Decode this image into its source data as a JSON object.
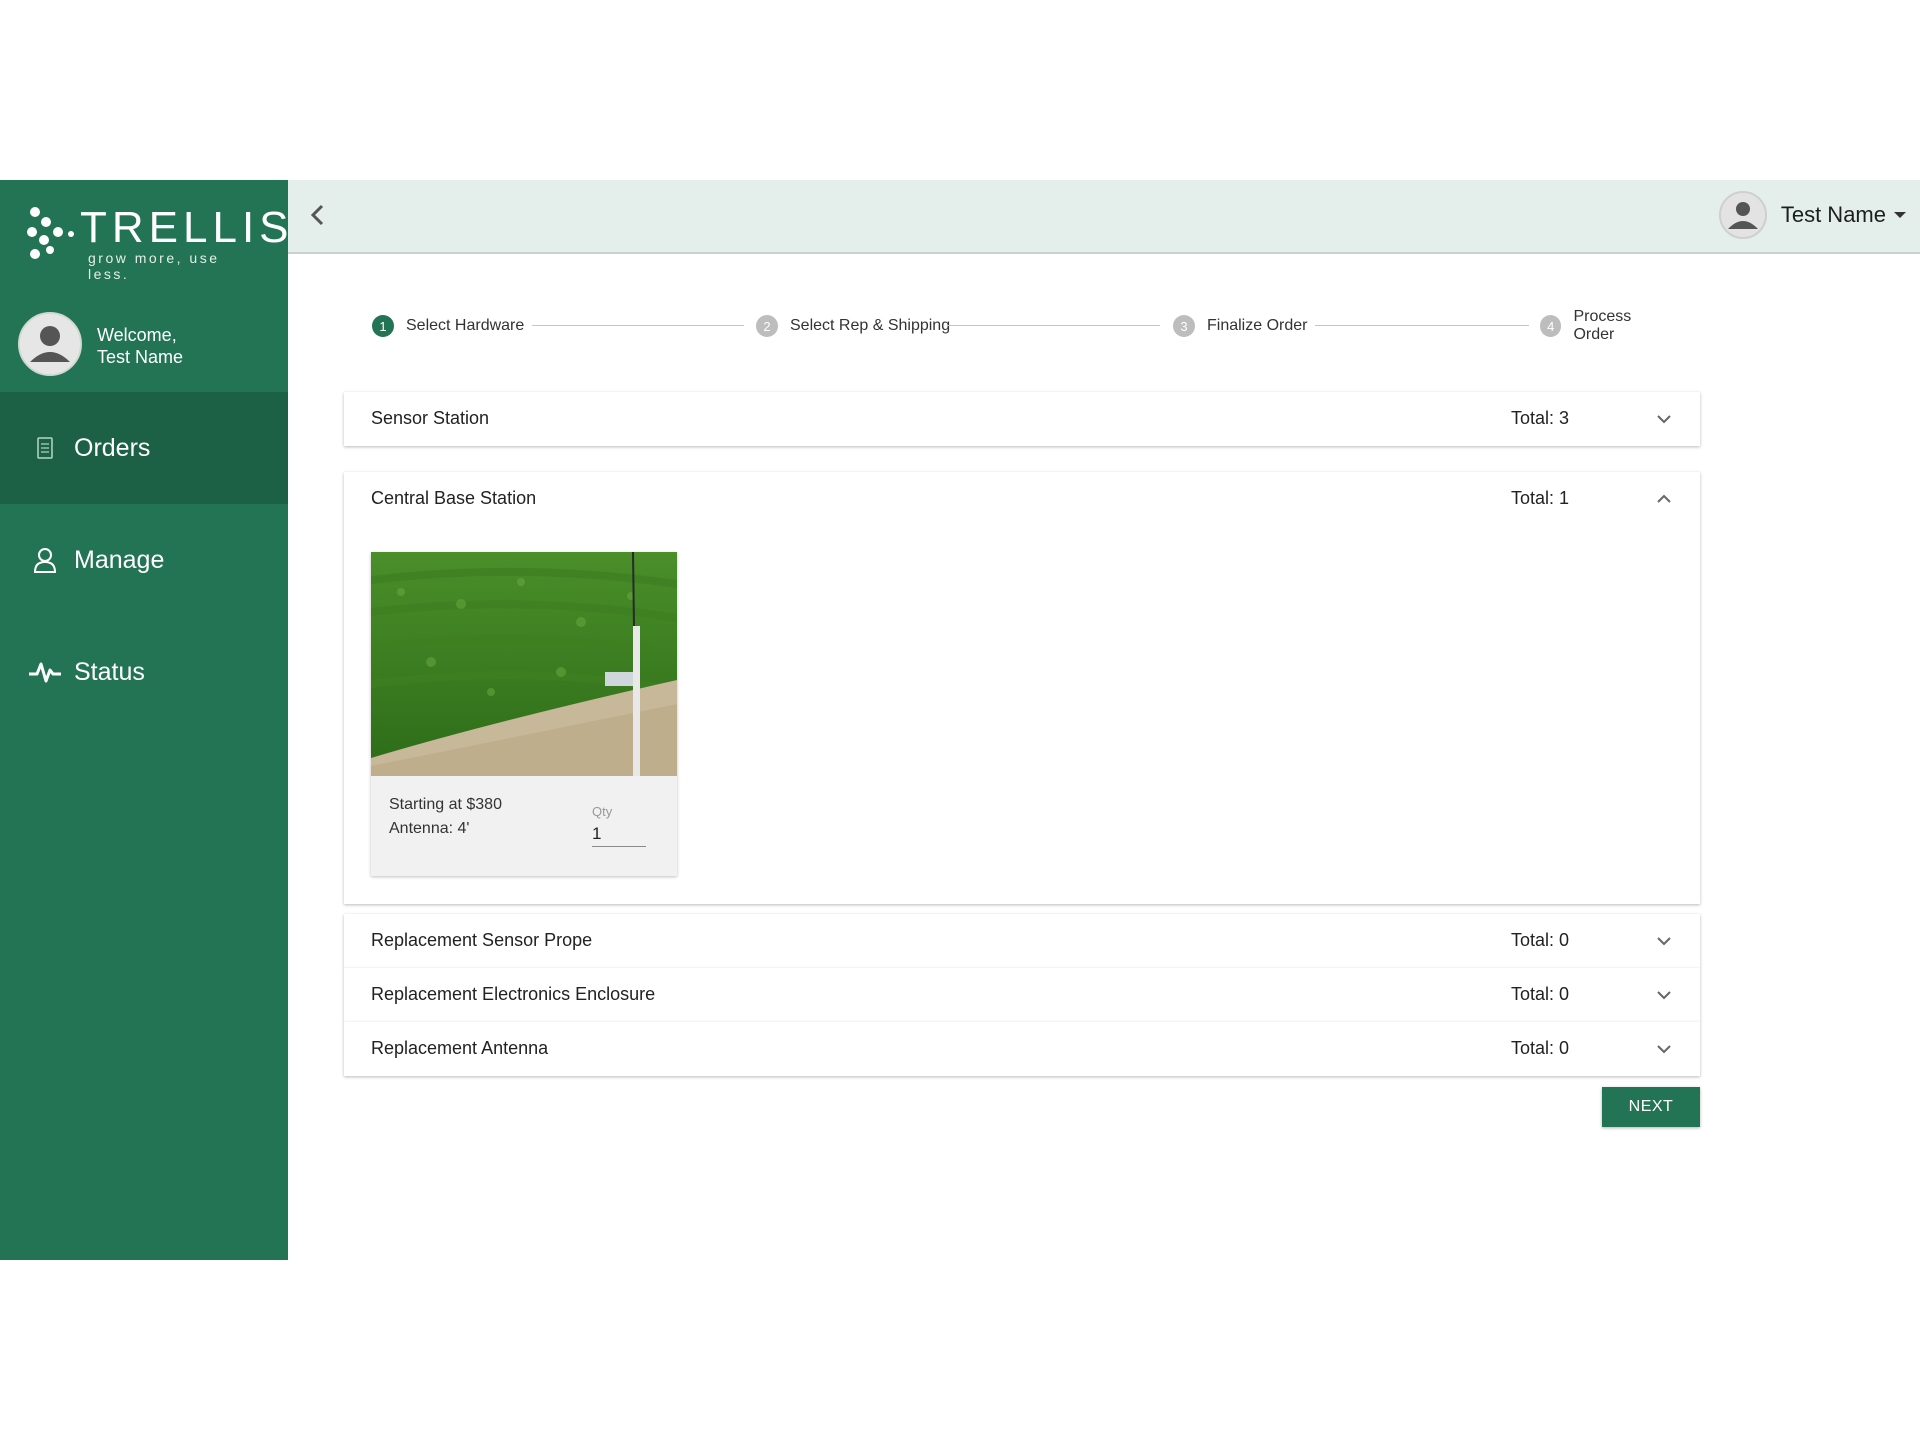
{
  "brand": {
    "name": "TRELLIS",
    "tagline": "grow more, use less."
  },
  "sidebar": {
    "welcome_line": "Welcome,",
    "user_name": "Test Name",
    "items": [
      {
        "label": "Orders",
        "icon": "document-icon",
        "active": true
      },
      {
        "label": "Manage",
        "icon": "person-icon",
        "active": false
      },
      {
        "label": "Status",
        "icon": "pulse-icon",
        "active": false
      }
    ]
  },
  "header": {
    "user_name": "Test Name"
  },
  "stepper": {
    "steps": [
      {
        "num": "1",
        "label": "Select Hardware",
        "active": true
      },
      {
        "num": "2",
        "label": "Select Rep & Shipping",
        "active": false
      },
      {
        "num": "3",
        "label": "Finalize Order",
        "active": false
      },
      {
        "num": "4",
        "label": "Process Order",
        "active": false
      }
    ]
  },
  "panels": [
    {
      "title": "Sensor Station",
      "total": "Total: 3",
      "expanded": false
    },
    {
      "title": "Central Base Station",
      "total": "Total: 1",
      "expanded": true,
      "product": {
        "price": "Starting at $380",
        "antenna": "Antenna: 4'",
        "qty_label": "Qty",
        "qty": "1"
      }
    },
    {
      "title": "Replacement Sensor Prope",
      "total": "Total: 0",
      "expanded": false
    },
    {
      "title": "Replacement Electronics Enclosure",
      "total": "Total: 0",
      "expanded": false
    },
    {
      "title": "Replacement Antenna",
      "total": "Total: 0",
      "expanded": false
    }
  ],
  "actions": {
    "next_label": "NEXT"
  },
  "colors": {
    "primary": "#237455",
    "primary_dark": "#1c6146",
    "header_bg": "#e4eeeb"
  }
}
